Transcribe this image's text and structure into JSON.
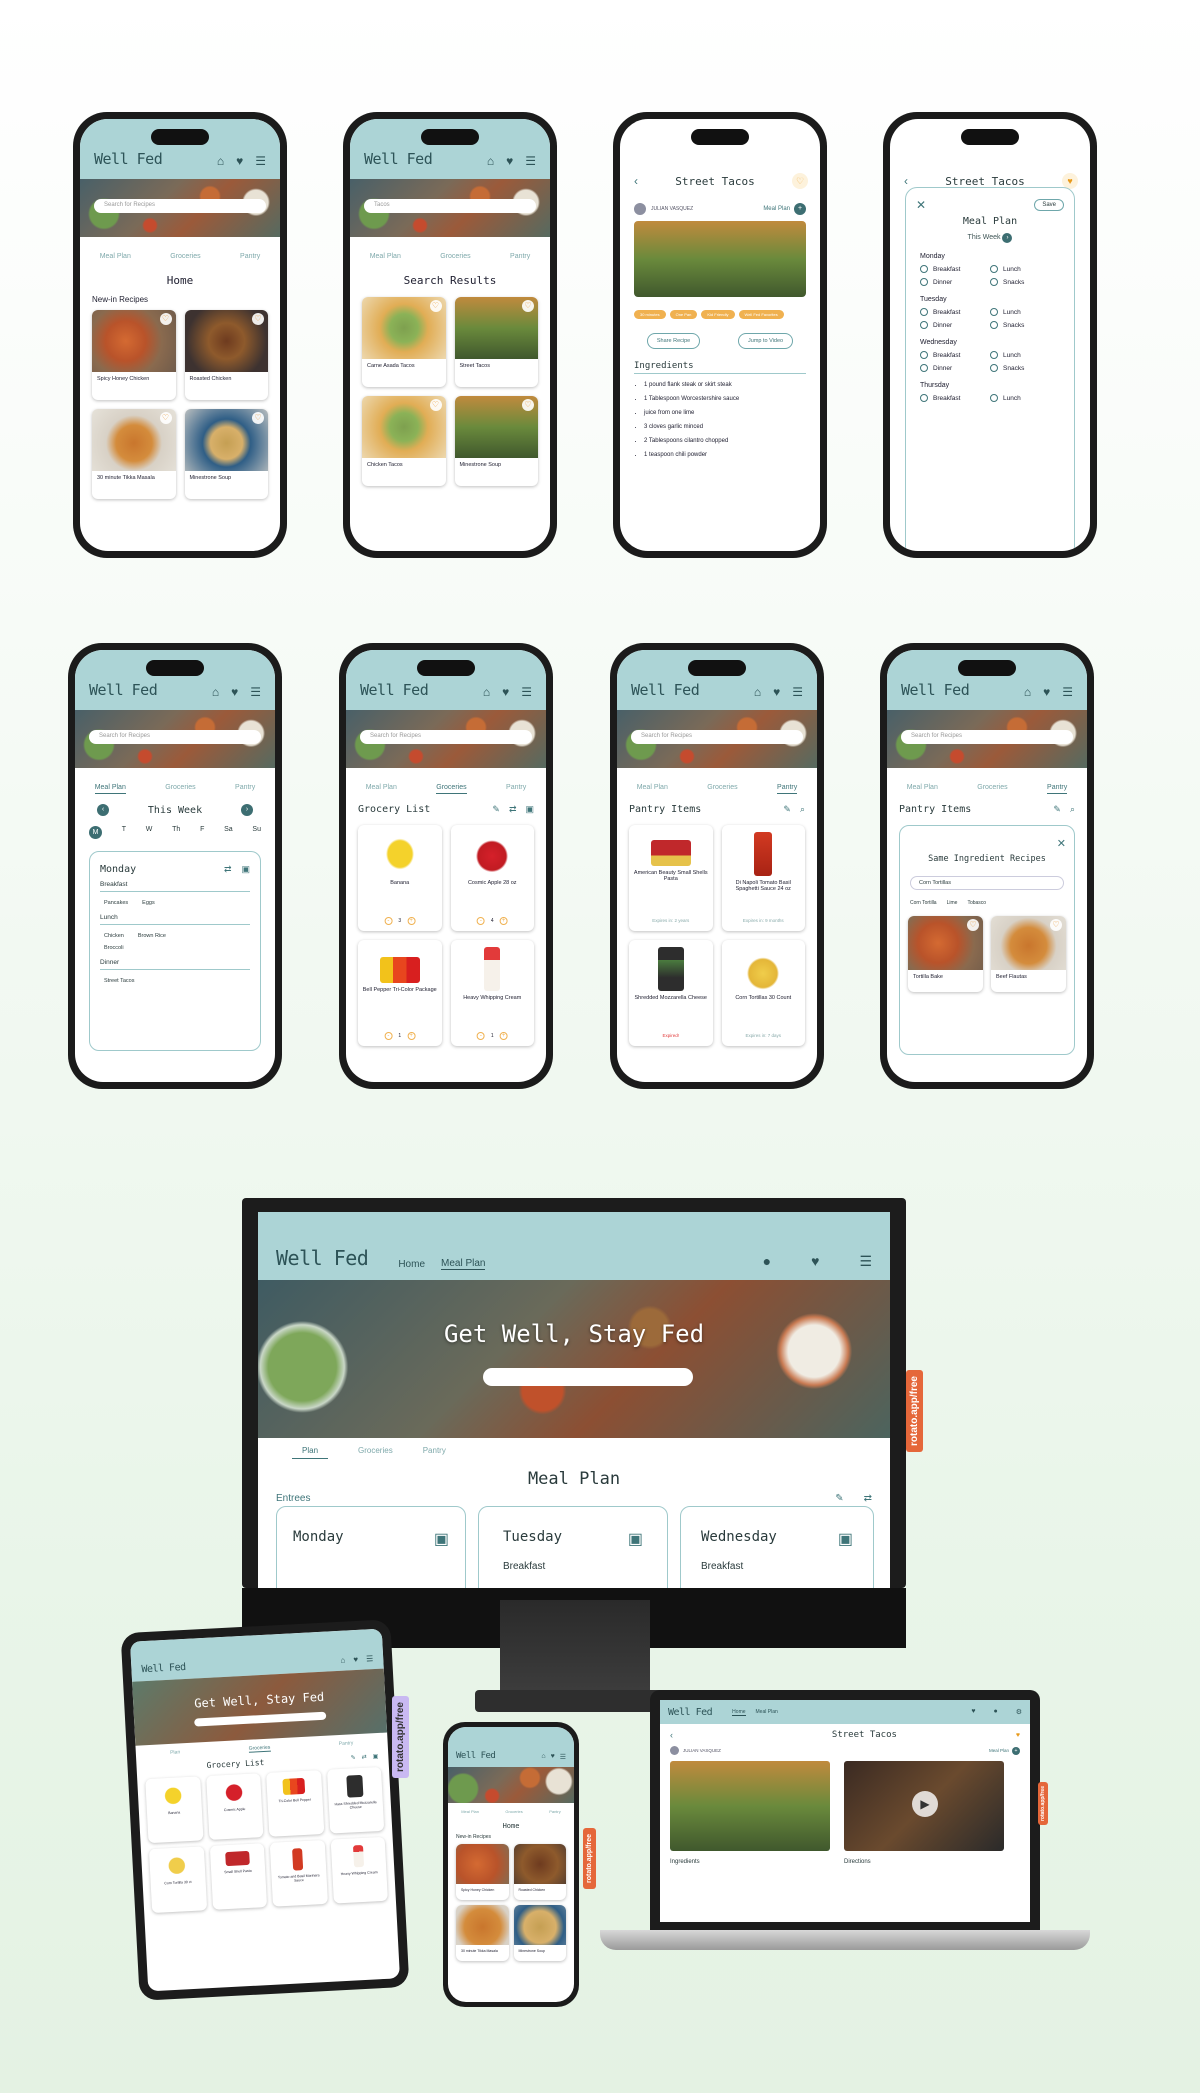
{
  "brand": {
    "logo": "Well Fed",
    "teal": "#acd4d6",
    "dark_teal": "#3d6e72",
    "accent": "#f0b150",
    "orange": "#e5673a"
  },
  "tabs": [
    "Meal Plan",
    "Groceries",
    "Pantry"
  ],
  "icons": {
    "home": "home-icon",
    "heart": "heart-icon",
    "menu": "menu-icon"
  },
  "phone1": {
    "search_placeholder": "Search for Recipes",
    "title": "Home",
    "section": "New-in Recipes",
    "recipes": [
      "Spicy Honey Chicken",
      "Roasted Chicken",
      "30 minute Tikka Masala",
      "Minestrone Soup"
    ]
  },
  "phone2": {
    "search_value": "Tacos",
    "title": "Search Results",
    "recipes": [
      "Carne Asada Tacos",
      "Street Tacos",
      "Chicken Tacos",
      "Minestrone Soup"
    ]
  },
  "phone3": {
    "title": "Street Tacos",
    "author": "JULIAN VASQUEZ",
    "meal_plan": "Meal Plan",
    "tags": [
      "30 minutes",
      "One Pan",
      "Kid Friendly",
      "Well Fed Favorites"
    ],
    "share": "Share Recipe",
    "jump": "Jump to Video",
    "ingredients_title": "Ingredients",
    "ingredients": [
      "1 pound flank steak or skirt steak",
      "1 Tablespoon Worcestershire sauce",
      "juice from one lime",
      "3 cloves garlic minced",
      "2 Tablespoons cilantro chopped",
      "1 teaspoon chili powder"
    ]
  },
  "phone4": {
    "title": "Street Tacos",
    "save": "Save",
    "heading": "Meal Plan",
    "week": "This Week",
    "days": [
      "Monday",
      "Tuesday",
      "Wednesday",
      "Thursday"
    ],
    "options": [
      "Breakfast",
      "Lunch",
      "Dinner",
      "Snacks"
    ]
  },
  "phone5": {
    "search_placeholder": "Search for Recipes",
    "week": "This Week",
    "days": [
      "M",
      "T",
      "W",
      "Th",
      "F",
      "Sa",
      "Su"
    ],
    "day": "Monday",
    "breakfast": "Breakfast",
    "b_items": [
      "Pancakes",
      "Eggs"
    ],
    "lunch": "Lunch",
    "l_items": [
      "Chicken",
      "Brown Rice",
      "Broccoli"
    ],
    "dinner": "Dinner",
    "d_items": [
      "Street Tacos"
    ]
  },
  "phone6": {
    "search_placeholder": "Search for Recipes",
    "title": "Grocery List",
    "items": [
      {
        "name": "Banana",
        "qty": "3"
      },
      {
        "name": "Cosmic Apple 28 oz",
        "qty": "4"
      },
      {
        "name": "Bell Pepper Tri-Color Package",
        "qty": "1"
      },
      {
        "name": "Heavy Whipping Cream",
        "qty": "1"
      }
    ]
  },
  "phone7": {
    "search_placeholder": "Search for Recipes",
    "title": "Pantry Items",
    "items": [
      {
        "name": "American Beauty Small Shells Pasta",
        "note": "Expires in: 2 years"
      },
      {
        "name": "Di Napoli Tomato Basil Spaghetti Sauce 24 oz",
        "note": "Expires in: 9 months"
      },
      {
        "name": "Shredded Mozzarella Cheese",
        "note": "Expired!"
      },
      {
        "name": "Corn Tortillas 30 Count",
        "note": "Expires in: 7 days"
      }
    ]
  },
  "phone8": {
    "search_placeholder": "Search for Recipes",
    "title": "Pantry Items",
    "heading": "Same Ingredient Recipes",
    "input": "Corn Tortillas",
    "chips": [
      "Corn Tortilla",
      "Lime",
      "Tobasco"
    ],
    "recipes": [
      "Tortilla Bake",
      "Beef Flautas"
    ]
  },
  "desktop": {
    "nav": [
      "Home",
      "Meal Plan"
    ],
    "hero": "Get Well, Stay Fed",
    "tabs": [
      "Plan",
      "Groceries",
      "Pantry"
    ],
    "title": "Meal Plan",
    "entrees": "Entrees",
    "days": [
      "Monday",
      "Tuesday",
      "Wednesday"
    ],
    "breakfast": "Breakfast"
  },
  "badge": "rotato.app/free",
  "tablet": {
    "hero": "Get Well, Stay Fed",
    "tabs": [
      "Plan",
      "Groceries",
      "Pantry"
    ],
    "title": "Grocery List",
    "items": [
      "Banana",
      "Cosmic Apple",
      "Tri-Color Bell Pepper",
      "Hass Shredded Mozzarella Cheese",
      "Corn Tortilla 30 ct",
      "Small Shell Pasta",
      "Tomato and Basil Marinara Sauce",
      "Heavy Whipping Cream"
    ]
  },
  "small_phone": {
    "title": "Home",
    "section": "New-in Recipes",
    "recipes": [
      "Spicy Honey Chicken",
      "Roasted Chicken",
      "30 minute Tikka Masala",
      "Minestrone Soup"
    ]
  },
  "laptop": {
    "nav": [
      "Home",
      "Meal Plan"
    ],
    "title": "Street Tacos",
    "author": "JULIAN VASQUEZ",
    "meal_plan": "Meal Plan",
    "ingredients": "Ingredients",
    "directions": "Directions"
  }
}
